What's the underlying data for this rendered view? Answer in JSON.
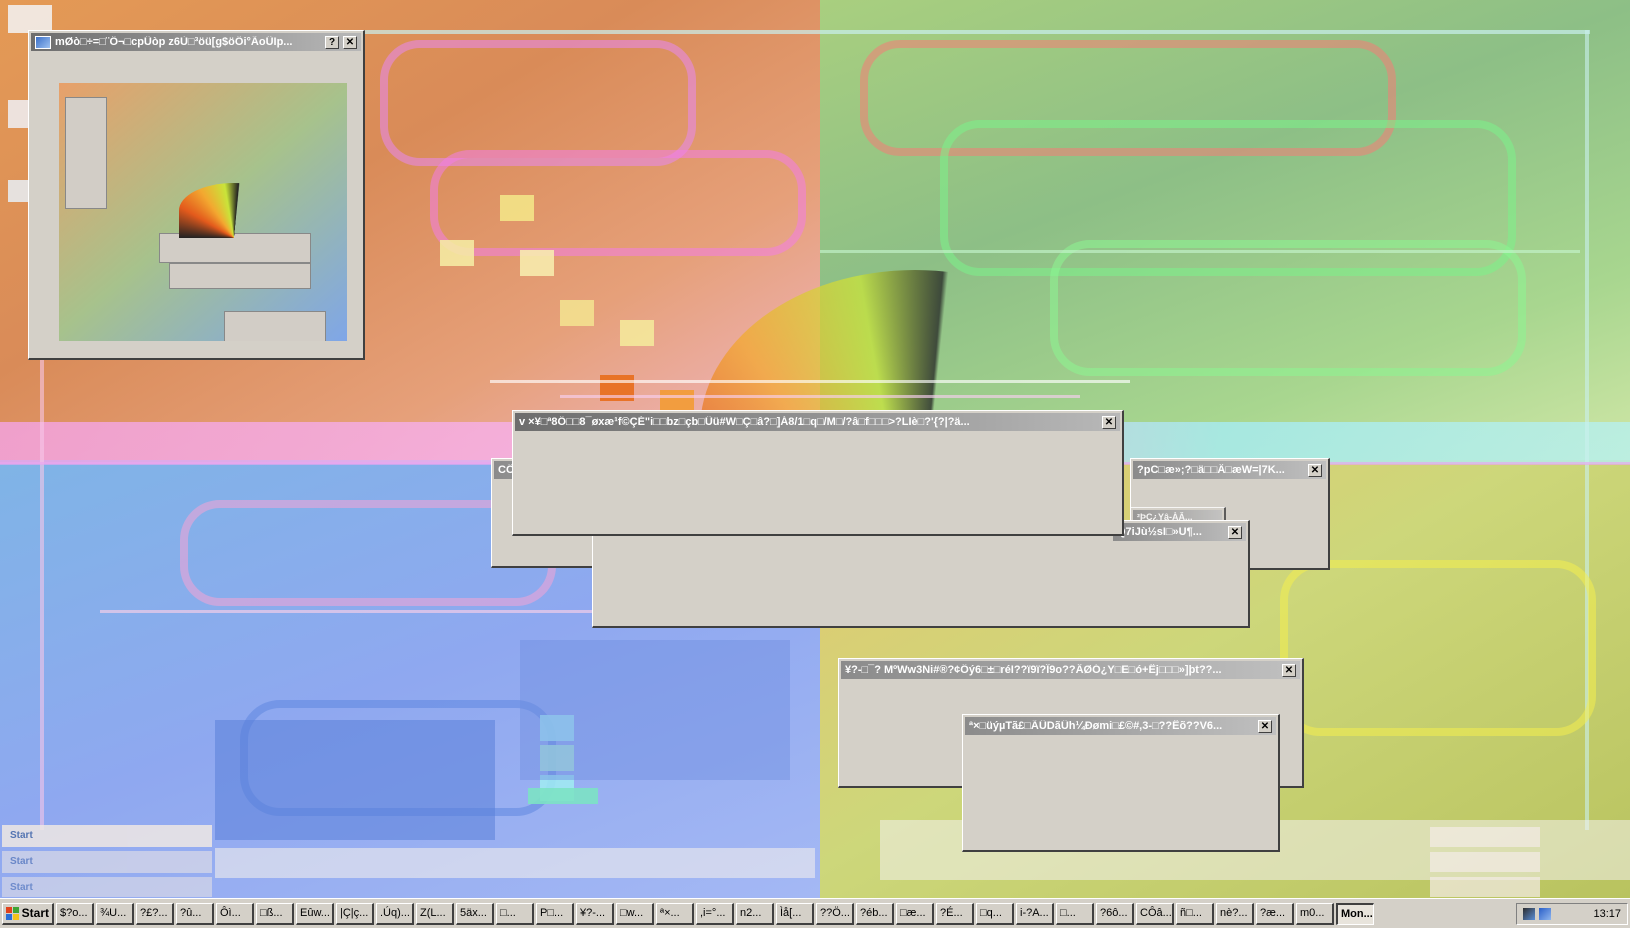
{
  "windows": {
    "top_left": {
      "title": "mØò□÷=□¨Ö¬□cpÜòp z6Ù□³öü[g$öÖi°ÃoÜIp..."
    },
    "main": {
      "title": "v ×¥□ª8Ö□□8¯øxæ¹f©ÇÉ\"i□□bz□çb□Üü#W□Ç□â?□]Á8/1□q□/M□/?â□f□□□>?LIè□?'{?|?ä..."
    },
    "right_1": {
      "title": "?pC□æ»;?□ä□□Ä□æW=|7K..."
    },
    "lower_1": {
      "title": "¥?-□¯?  MºWw3Ni#®?¢Ôý6□±□réI??ï9ï?Î9o??ÂØÓ¿Y□E□ó+Ëj□□□»]þt??..."
    },
    "lower_2": {
      "title": "ª×□üýµTã£□ÃÛDãÜh¼Ðømi□£©#,3-□??Ëõ??V6..."
    },
    "ghost_left": {
      "title": "CÖ"
    },
    "ghost_small": {
      "title": "Q7iJù½sI□»U¶..."
    },
    "ghost_tiny": {
      "title": "²ÞÇ¿Yâ-ÀÂ..."
    }
  },
  "buttons": {
    "help": "?",
    "close": "✕"
  },
  "ghost_start_label": "Start",
  "taskbar": {
    "start_label": "Start",
    "tasks": [
      "$?o...",
      "¾U...",
      "?£?...",
      "?û...",
      "Ôì...",
      "□ß...",
      "Eûw...",
      "|Ç|ç...",
      ".Úq)...",
      "Z(L...",
      "5äx...",
      "□...",
      "P□...",
      "¥?-...",
      "□w...",
      "ª×...",
      ",i=°...",
      "n2...",
      "Ìå[...",
      "??Ö...",
      "?éb...",
      "□æ...",
      "?É...",
      "□q...",
      "i-?A...",
      "□...",
      "?6ô...",
      "CÔâ...",
      "ñ□...",
      "nè?...",
      "?æ...",
      "m0...",
      "Mon..."
    ],
    "active_task_index": 32,
    "clock": "13:17"
  },
  "colors": {
    "title_inactive": "#8b8b8b",
    "window_face": "#d4d0c8",
    "wallpaper_orange": "#e49a55",
    "wallpaper_green": "#a9cf7f",
    "wallpaper_blue": "#7fb4e6",
    "wallpaper_yellow": "#e3c870"
  }
}
